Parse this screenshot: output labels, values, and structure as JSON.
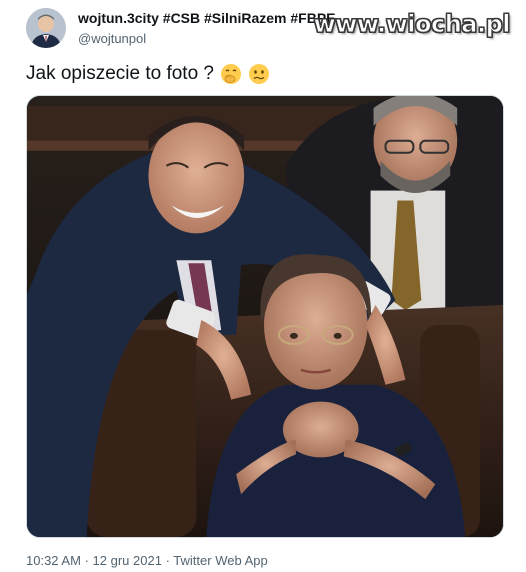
{
  "tweet": {
    "display_name": "wojtun.3city #CSB #SilniRazem #FBPE",
    "handle": "@wojtunpol",
    "text": "Jak opiszecie to foto ?",
    "emojis": [
      "face-with-hand-over-mouth",
      "confused-face"
    ],
    "time": "10:32 AM",
    "separator": "·",
    "date": "12 gru 2021",
    "source": "Twitter Web App"
  },
  "watermark": {
    "text": "www.wiocha.pl"
  },
  "photo": {
    "description_icon": "photo-image"
  },
  "colors": {
    "text_primary": "#0f1419",
    "text_secondary": "#536471",
    "border": "#cfd9de"
  }
}
